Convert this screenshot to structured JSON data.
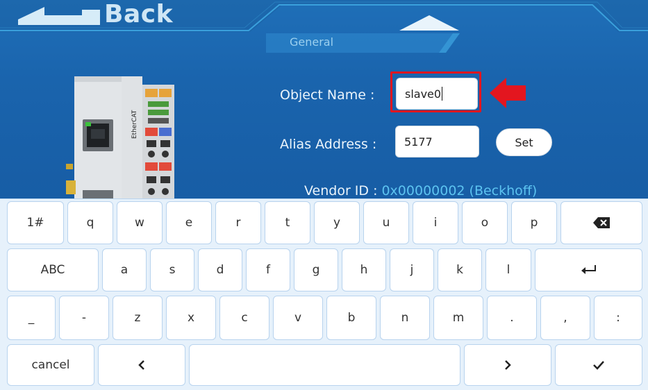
{
  "header": {
    "back_label": "Back",
    "tab_label": "General",
    "colors": {
      "panel_bg": "#1a64ad",
      "accent_line": "#3aa0dc",
      "highlight_red": "#e3161f",
      "link_blue": "#5cc3f0"
    }
  },
  "device": {
    "brand_text": "EtherCAT"
  },
  "form": {
    "object_name_label": "Object Name :",
    "object_name_value": "slave0",
    "alias_label": "Alias Address :",
    "alias_value": "5177",
    "set_label": "Set",
    "vendor_label": "Vendor ID :",
    "vendor_value": "0x00000002 (Beckhoff)"
  },
  "keyboard": {
    "rows": [
      [
        "1#",
        "q",
        "w",
        "e",
        "r",
        "t",
        "y",
        "u",
        "i",
        "o",
        "p",
        "backspace-icon"
      ],
      [
        "ABC",
        "a",
        "s",
        "d",
        "f",
        "g",
        "h",
        "j",
        "k",
        "l",
        "enter-icon"
      ],
      [
        "_",
        "-",
        "z",
        "x",
        "c",
        "v",
        "b",
        "n",
        "m",
        ".",
        ",",
        ":"
      ],
      [
        "cancel",
        "chevron-left-icon",
        "space",
        "chevron-right-icon",
        "check-icon"
      ]
    ]
  }
}
